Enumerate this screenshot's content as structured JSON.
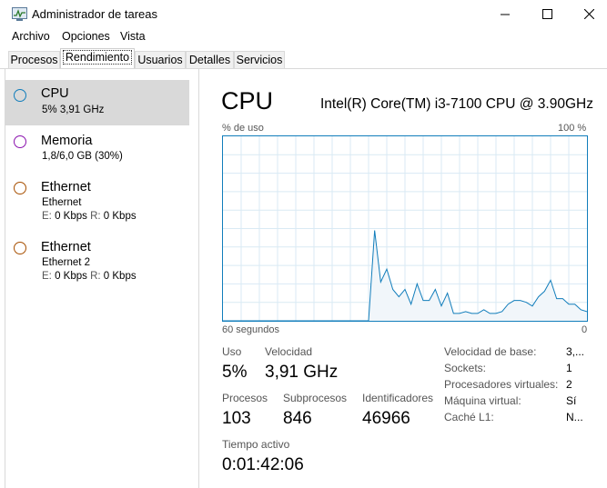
{
  "window": {
    "title": "Administrador de tareas"
  },
  "menu": [
    "Archivo",
    "Opciones",
    "Vista"
  ],
  "tabs": [
    "Procesos",
    "Rendimiento",
    "Usuarios",
    "Detalles",
    "Servicios"
  ],
  "active_tab": "Rendimiento",
  "sidebar": {
    "items": [
      {
        "name": "CPU",
        "lines": [
          "5% 3,91 GHz"
        ],
        "color": "#117dbb",
        "selected": true
      },
      {
        "name": "Memoria",
        "lines": [
          "1,8/6,0 GB (30%)"
        ],
        "color": "#8b12ae",
        "selected": false
      },
      {
        "name": "Ethernet",
        "lines": [
          "Ethernet"
        ],
        "send_label": "E:",
        "send_value": "0 Kbps",
        "recv_label": "R:",
        "recv_value": "0 Kbps",
        "color": "#a74f01",
        "selected": false
      },
      {
        "name": "Ethernet",
        "lines": [
          "Ethernet 2"
        ],
        "send_label": "E:",
        "send_value": "0 Kbps",
        "recv_label": "R:",
        "recv_value": "0 Kbps",
        "color": "#a74f01",
        "selected": false
      }
    ]
  },
  "main": {
    "heading": "CPU",
    "model": "Intel(R) Core(TM) i3-7100 CPU @ 3.90GHz",
    "graph_top_left": "% de uso",
    "graph_top_right": "100 %",
    "graph_bottom_left": "60 segundos",
    "graph_bottom_right": "0",
    "stats": {
      "uso_label": "Uso",
      "uso_value": "5%",
      "velocidad_label": "Velocidad",
      "velocidad_value": "3,91 GHz",
      "procesos_label": "Procesos",
      "procesos_value": "103",
      "subprocesos_label": "Subprocesos",
      "subprocesos_value": "846",
      "identificadores_label": "Identificadores",
      "identificadores_value": "46966",
      "tiempo_label": "Tiempo activo",
      "tiempo_value": "0:01:42:06"
    },
    "details": [
      {
        "label": "Velocidad de base:",
        "value": "3,..."
      },
      {
        "label": "Sockets:",
        "value": "1"
      },
      {
        "label": "Procesadores virtuales:",
        "value": "2"
      },
      {
        "label": "Máquina virtual:",
        "value": "Sí"
      },
      {
        "label": "Caché L1:",
        "value": "N..."
      }
    ]
  },
  "chart_data": {
    "type": "area",
    "x_range": [
      60,
      0
    ],
    "ylim": [
      0,
      100
    ],
    "color": "#117dbb",
    "fill": "#f1f6fa",
    "x": [
      60,
      36,
      35,
      34,
      33,
      32,
      31,
      30,
      29,
      28,
      27,
      26,
      25,
      24,
      23,
      22,
      21,
      20,
      19,
      18,
      17,
      16,
      15,
      14,
      13,
      12,
      11,
      10,
      9,
      8,
      7,
      6,
      5,
      4,
      3,
      2,
      1,
      0
    ],
    "values": [
      0,
      0,
      49,
      21,
      28,
      17,
      13,
      17,
      9,
      20,
      11,
      11,
      17,
      8,
      15,
      4,
      4,
      5,
      4,
      4,
      6,
      4,
      4,
      5,
      9,
      11,
      11,
      10,
      8,
      13,
      16,
      22,
      12,
      12,
      9,
      9,
      6,
      5
    ]
  }
}
